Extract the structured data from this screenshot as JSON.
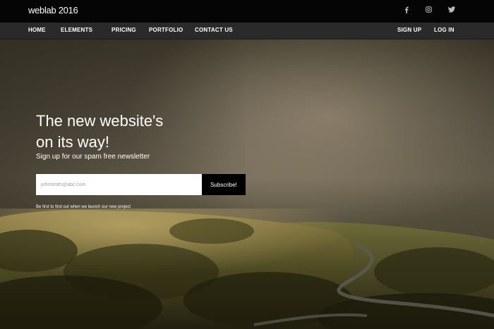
{
  "brand": {
    "name": "weblab 2016"
  },
  "social": [
    {
      "icon": "facebook-icon",
      "glyph": "f"
    },
    {
      "icon": "instagram-icon",
      "glyph": "◎"
    },
    {
      "icon": "twitter-icon",
      "glyph": ""
    }
  ],
  "nav": {
    "left": [
      "HOME",
      "ELEMENTS",
      "PRICING",
      "PORTFOLIO",
      "CONTACT US"
    ],
    "right": [
      "SIGN UP",
      "LOG IN"
    ]
  },
  "hero": {
    "headline_line1": "The new website's",
    "headline_line2": "on its way!",
    "subline": "Sign up for our spam free newsletter",
    "email_placeholder": "johnsmith@abc.com",
    "subscribe_label": "Subscribe!",
    "note": "Be first to find out when we launch our new project"
  },
  "colors": {
    "topbar": "#050505",
    "navbar": "#2a2a2a",
    "button": "#000000",
    "text": "#ffffff"
  }
}
